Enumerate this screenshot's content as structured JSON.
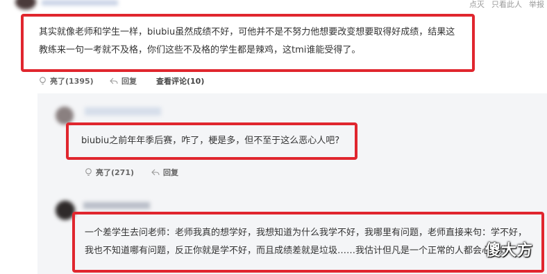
{
  "top_actions": [
    "点灭",
    "只看此人",
    "举报"
  ],
  "comment1": {
    "text": "其实就像老师和学生一样，biubiu虽然成绩不好，可他并不是不努力他想要改变想要取得好成绩，结果这教练来一句一考就不及格，你们这些不及格的学生都是辣鸡，这tmi谁能受得了。",
    "like_label": "亮了(1395)",
    "reply_label": "回复",
    "view_replies_label": "查看评论(10)"
  },
  "reply1": {
    "text": "biubiu之前年年季后赛，咋了，梗是多，但不至于这么恶心人吧?",
    "like_label": "亮了(271)",
    "reply_label": "回复"
  },
  "reply2": {
    "text": "一个差学生去问老师：老师我真的想学好，我想知道为什么我学不好，我哪里有问题，老师直接来句：学不好，我也不知道哪有问题，反正你就是学不好，而且成绩差就是垃圾……我估计但凡是一个正常的人都会心态炸"
  },
  "watermark": "傻大方",
  "colors": {
    "highlight": "#e0262e",
    "panel": "#f4f5f7",
    "text": "#333333"
  }
}
